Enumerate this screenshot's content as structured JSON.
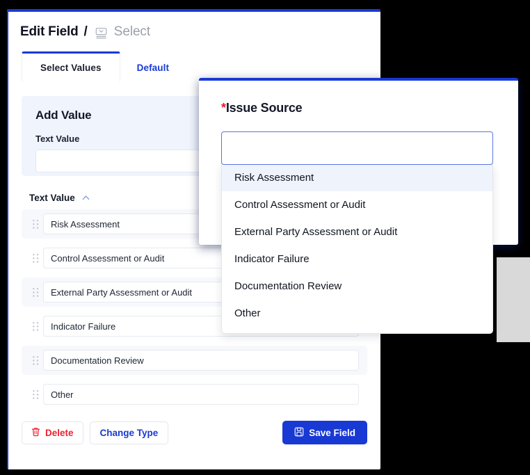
{
  "panel": {
    "header": {
      "title": "Edit Field",
      "separator": "/",
      "type_icon": "select-field-icon",
      "type_label": "Select"
    },
    "tabs": [
      {
        "label": "Select Values",
        "active": true
      },
      {
        "label": "Default",
        "active": false
      }
    ],
    "add_value": {
      "card_title": "Add Value",
      "field_label": "Text Value",
      "input_value": "",
      "input_placeholder": ""
    },
    "list": {
      "column_header": "Text Value",
      "sort_icon": "chevron-up-icon",
      "rows": [
        {
          "value": "Risk Assessment"
        },
        {
          "value": "Control Assessment or Audit"
        },
        {
          "value": "External Party Assessment or Audit"
        },
        {
          "value": "Indicator Failure"
        },
        {
          "value": "Documentation Review"
        },
        {
          "value": "Other"
        }
      ]
    },
    "footer": {
      "delete_label": "Delete",
      "delete_icon": "trash-icon",
      "change_type_label": "Change Type",
      "save_label": "Save Field",
      "save_icon": "save-disk-icon"
    }
  },
  "overlay": {
    "required_marker": "*",
    "label": "Issue Source",
    "combobox": {
      "value": "",
      "placeholder": ""
    },
    "options": [
      {
        "label": "Risk Assessment",
        "highlighted": true
      },
      {
        "label": "Control Assessment or Audit",
        "highlighted": false
      },
      {
        "label": "External Party Assessment or Audit",
        "highlighted": false
      },
      {
        "label": "Indicator Failure",
        "highlighted": false
      },
      {
        "label": "Documentation Review",
        "highlighted": false
      },
      {
        "label": "Other",
        "highlighted": false
      }
    ]
  },
  "colors": {
    "brand_blue": "#1939d4",
    "danger_red": "#f01f2e",
    "required_red": "#e8192c",
    "card_bg": "#f0f4fd",
    "row_shade": "#f7f8fc",
    "option_highlight": "#eff3fb",
    "muted_text": "#9aa0ab",
    "grey_block": "#d9d9d9"
  }
}
